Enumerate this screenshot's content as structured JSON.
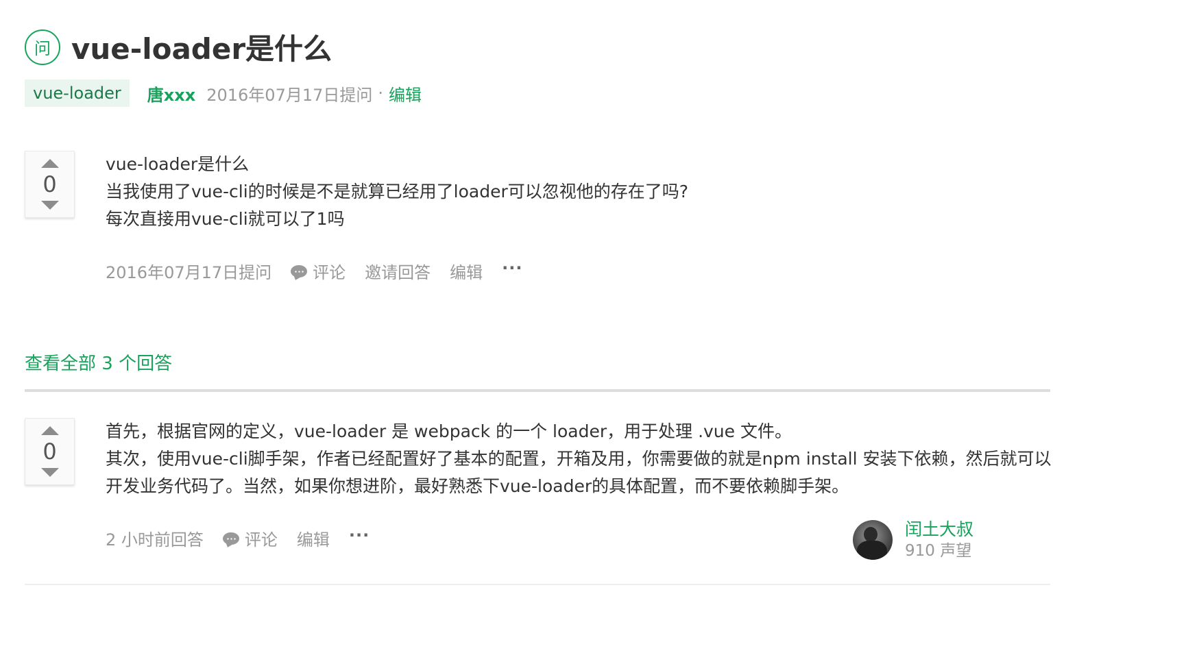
{
  "question": {
    "badge": "问",
    "title": "vue-loader是什么",
    "tag": "vue-loader",
    "author": "唐xxx",
    "asked_date": "2016年07月17日提问",
    "separator": "·",
    "edit_label": "编辑",
    "votes": "0",
    "body_lines": [
      "vue-loader是什么",
      "当我使用了vue-cli的时候是不是就算已经用了loader可以忽视他的存在了吗?",
      "每次直接用vue-cli就可以了1吗"
    ],
    "actions": {
      "date": "2016年07月17日提问",
      "comment": "评论",
      "invite": "邀请回答",
      "edit": "编辑",
      "more": "···"
    }
  },
  "view_all_answers": "查看全部 3 个回答",
  "answer": {
    "votes": "0",
    "body_lines": [
      "首先，根据官网的定义，vue-loader 是 webpack 的一个 loader，用于处理 .vue 文件。",
      "其次，使用vue-cli脚手架，作者已经配置好了基本的配置，开箱及用，你需要做的就是npm install 安装下依赖，然后就可以",
      "开发业务代码了。当然，如果你想进阶，最好熟悉下vue-loader的具体配置，而不要依赖脚手架。"
    ],
    "actions": {
      "time": "2 小时前回答",
      "comment": "评论",
      "edit": "编辑",
      "more": "···"
    },
    "user": {
      "name": "闰土大叔",
      "reputation": "910 声望"
    }
  },
  "colors": {
    "accent": "#17a35c",
    "muted": "#999999",
    "tag_bg": "#e9f5ee"
  }
}
